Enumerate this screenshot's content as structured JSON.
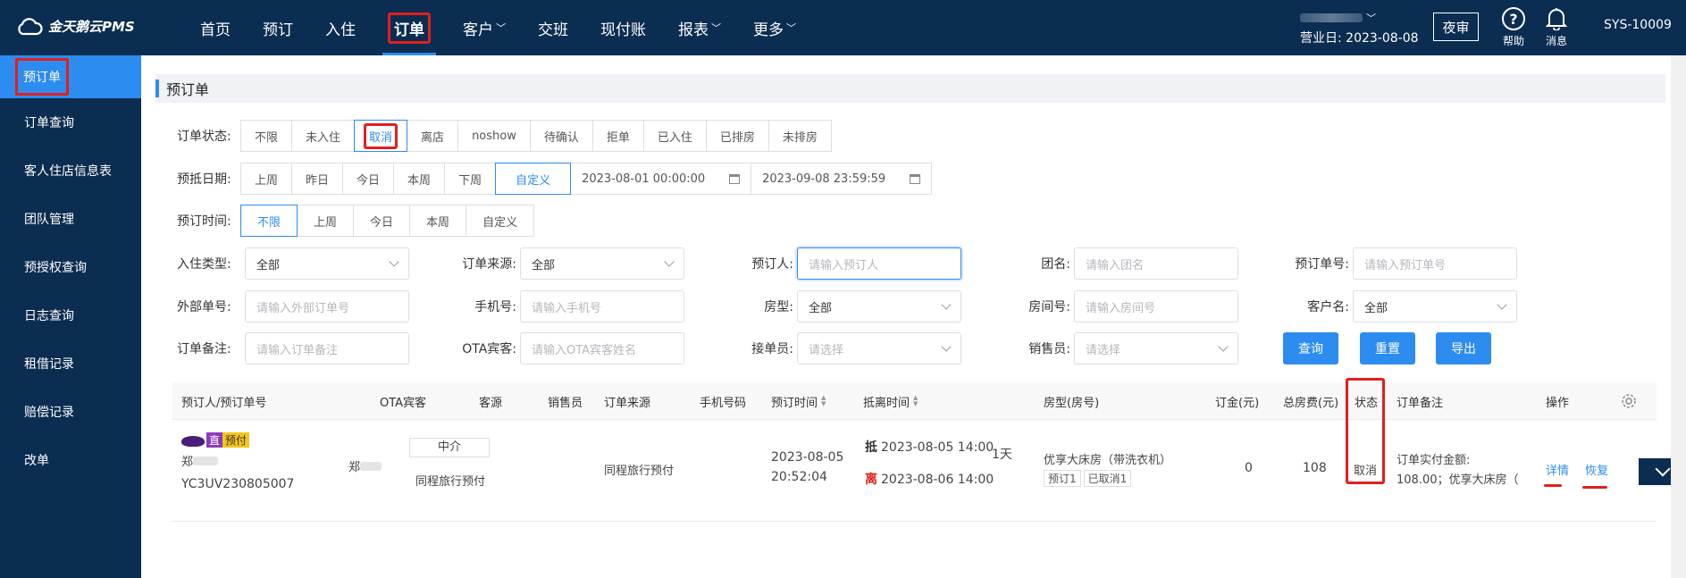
{
  "app": {
    "logo": "金天鹅云PMS"
  },
  "nav": [
    {
      "label": "首页",
      "dropdown": false
    },
    {
      "label": "预订",
      "dropdown": false
    },
    {
      "label": "入住",
      "dropdown": false
    },
    {
      "label": "订单",
      "dropdown": false,
      "active": true
    },
    {
      "label": "客户",
      "dropdown": true
    },
    {
      "label": "交班",
      "dropdown": false
    },
    {
      "label": "现付账",
      "dropdown": false
    },
    {
      "label": "报表",
      "dropdown": true
    },
    {
      "label": "更多",
      "dropdown": true
    }
  ],
  "header": {
    "business_date": "营业日: 2023-08-08",
    "night_audit": "夜审",
    "help": "帮助",
    "messages": "消息",
    "sys": "SYS-10009"
  },
  "sidebar": [
    "预订单",
    "订单查询",
    "客人住店信息表",
    "团队管理",
    "预授权查询",
    "日志查询",
    "租借记录",
    "赔偿记录",
    "改单"
  ],
  "page_title": "预订单",
  "filters": {
    "status_label": "订单状态:",
    "status_options": [
      "不限",
      "未入住",
      "取消",
      "离店",
      "noshow",
      "待确认",
      "拒单",
      "已入住",
      "已排房",
      "未排房"
    ],
    "status_selected": "取消",
    "arrival_label": "预抵日期:",
    "arrival_options": [
      "上周",
      "昨日",
      "今日",
      "本周",
      "下周",
      "自定义"
    ],
    "arrival_selected": "自定义",
    "arrival_start": "2023-08-01 00:00:00",
    "arrival_end": "2023-09-08 23:59:59",
    "booking_label": "预订时间:",
    "booking_options": [
      "不限",
      "上周",
      "今日",
      "本周",
      "自定义"
    ],
    "booking_selected": "不限",
    "fields": {
      "checkin_type": {
        "label": "入住类型:",
        "value": "全部"
      },
      "order_source": {
        "label": "订单来源:",
        "value": "全部"
      },
      "booker": {
        "label": "预订人:",
        "placeholder": "请输入预订人"
      },
      "group_name": {
        "label": "团名:",
        "placeholder": "请输入团名"
      },
      "booking_no": {
        "label": "预订单号:",
        "placeholder": "请输入预订单号"
      },
      "external_no": {
        "label": "外部单号:",
        "placeholder": "请输入外部订单号"
      },
      "phone": {
        "label": "手机号:",
        "placeholder": "请输入手机号"
      },
      "room_type": {
        "label": "房型:",
        "value": "全部"
      },
      "room_no": {
        "label": "房间号:",
        "placeholder": "请输入房间号"
      },
      "customer_name": {
        "label": "客户名:",
        "value": "全部"
      },
      "order_remark": {
        "label": "订单备注:",
        "placeholder": "请输入订单备注"
      },
      "ota_guest": {
        "label": "OTA宾客:",
        "placeholder": "请输入OTA宾客姓名"
      },
      "receiver": {
        "label": "接单员:",
        "placeholder": "请选择"
      },
      "salesperson": {
        "label": "销售员:",
        "placeholder": "请选择"
      }
    },
    "buttons": {
      "query": "查询",
      "reset": "重置",
      "export": "导出"
    }
  },
  "table": {
    "headers": [
      "预订人/预订单号",
      "OTA宾客",
      "客源",
      "销售员",
      "订单来源",
      "手机号码",
      "预订时间",
      "抵离时间",
      "房型(房号)",
      "订金(元)",
      "总房费(元)",
      "状态",
      "订单备注",
      "操作"
    ],
    "rows": [
      {
        "badge_direct": "直",
        "badge_prepay": "预付",
        "booker": "郑",
        "order_no": "YC3UV230805007",
        "ota_guest": "郑",
        "source_chip": "中介",
        "source_text": "同程旅行预付",
        "order_source": "同程旅行预付",
        "booking_date": "2023-08-05",
        "booking_time": "20:52:04",
        "arrive_tag": "抵",
        "arrive": "2023-08-05 14:00",
        "depart_tag": "离",
        "depart": "2023-08-06 14:00",
        "nights": "1天",
        "room_type": "优享大床房（带洗衣机）",
        "room_tag1": "预订1",
        "room_tag2": "已取消1",
        "deposit": "0",
        "total": "108",
        "status": "取消",
        "remark_line1": "订单实付金额:",
        "remark_line2": "108.00；优享大床房（",
        "action_detail": "详情",
        "action_restore": "恢复"
      }
    ]
  }
}
